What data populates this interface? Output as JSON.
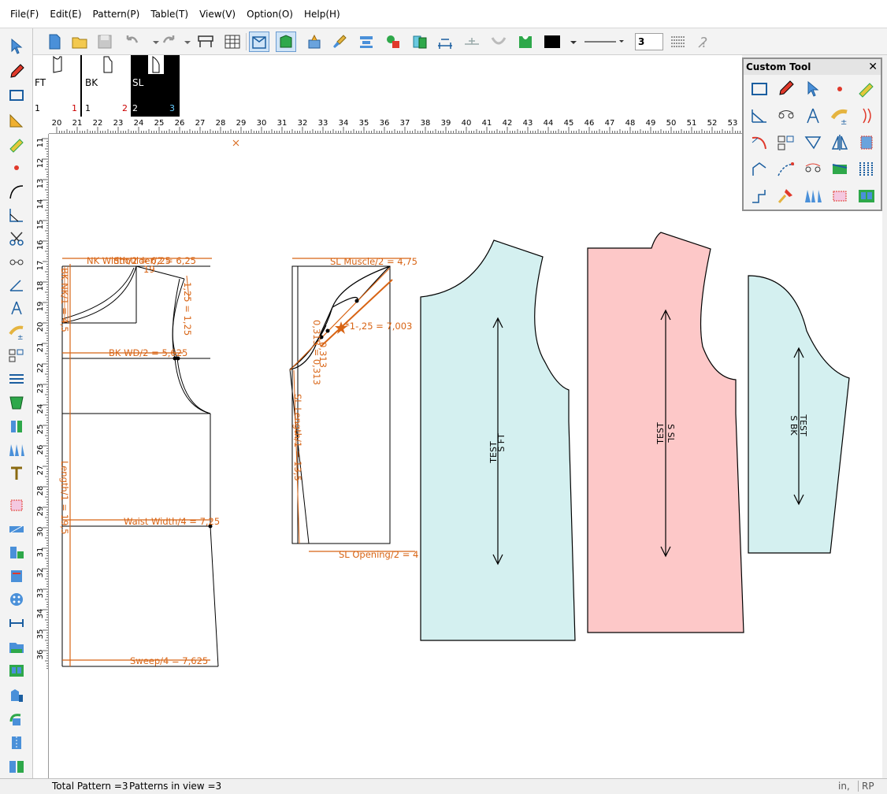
{
  "menu": {
    "items": [
      "File(F)",
      "Edit(E)",
      "Pattern(P)",
      "Table(T)",
      "View(V)",
      "Option(O)",
      "Help(H)"
    ]
  },
  "toolbar": {
    "line_width": "3"
  },
  "patterns": [
    {
      "name": "FT",
      "left": "1",
      "right": "1",
      "selected": false
    },
    {
      "name": "BK",
      "left": "1",
      "right": "2",
      "selected": false
    },
    {
      "name": "SL",
      "left": "2",
      "right": "3",
      "selected": true
    }
  ],
  "ruler": {
    "horizontal": [
      "20",
      "21",
      "22",
      "23",
      "24",
      "25",
      "26",
      "27",
      "28",
      "29",
      "30",
      "31",
      "32",
      "33",
      "34",
      "35",
      "36",
      "37",
      "38",
      "39",
      "40",
      "41",
      "42",
      "43",
      "44",
      "45",
      "46",
      "47",
      "48",
      "49",
      "50",
      "51",
      "52",
      "53"
    ],
    "vertical": [
      "11",
      "12",
      "13",
      "14",
      "15",
      "16",
      "17",
      "18",
      "19",
      "20",
      "21",
      "22",
      "23",
      "24",
      "25",
      "26",
      "27",
      "28",
      "29",
      "30",
      "31",
      "32",
      "33",
      "34",
      "35",
      "36"
    ]
  },
  "drafting": {
    "body": {
      "nk_width": "NK Width/2 = 6,25",
      "shoulder": "Shoulder/2 = 6,25",
      "bk_wd": "BK WD/2 = 5,625",
      "waist_width": "Waist Width/4 = 7,25",
      "sweep": "Sweep/4 = 7,625",
      "length": "Length/1 = 19,5",
      "vertical_1": "1,25 = 1,25",
      "left_vert": "BK NK/1 = 4,5",
      "small_19": "19"
    },
    "sleeve": {
      "muscle": "SL Muscle/2 = 4,75",
      "cap": "*1-,25 = 7,003",
      "length": "SL Length/1 = 13,5",
      "opening": "SL Opening/2 = 4",
      "diag1": "0,313 = 0,313",
      "diag2": "0,313"
    }
  },
  "pieces": [
    {
      "line1": "TEST",
      "line2": "S  FT",
      "color": "#d4f0f0"
    },
    {
      "line1": "TEST",
      "line2": "S  SL",
      "color": "#fdc8c8"
    },
    {
      "line1": "TEST",
      "line2": "S  BK",
      "color": "#d4f0f0"
    }
  ],
  "custom_tool": {
    "title": "Custom Tool",
    "close": "✕"
  },
  "status": {
    "total": "Total Pattern =3",
    "in_view": "Patterns in view =3",
    "unit": "in,",
    "mode": "RP"
  },
  "colors": {
    "draft_line": "#d86414",
    "piece_blue": "#d4f0f0",
    "piece_pink": "#fdc8c8"
  }
}
